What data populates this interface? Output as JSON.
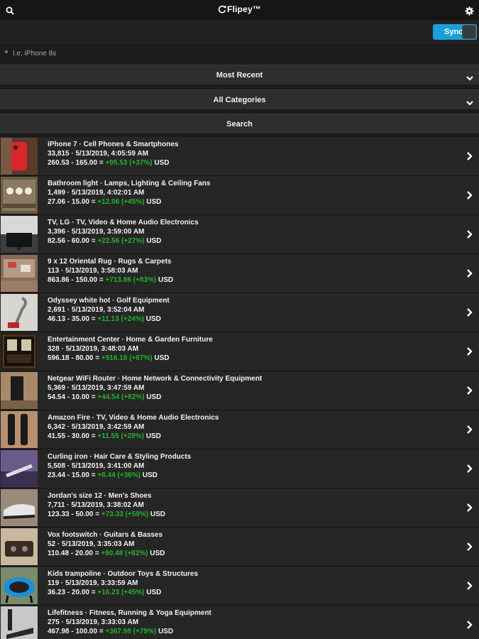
{
  "header": {
    "app_name": "Flipey™",
    "search_icon": "search-icon",
    "settings_icon": "gear-icon"
  },
  "sync": {
    "label": "Sync",
    "enabled": true,
    "color": "#1a9fd9"
  },
  "search": {
    "placeholder": "I.e. iPhone 8s",
    "value": ""
  },
  "sort": {
    "selected": "Most Recent"
  },
  "category": {
    "selected": "All Categories"
  },
  "search_button": "Search",
  "colors": {
    "gain": "#25b22c",
    "accent": "#1a9fd9"
  },
  "items": [
    {
      "title": "iPhone 7 · Cell Phones & Smartphones",
      "meta": "33,815 · 5/13/2019, 4:05:59 AM",
      "price_calc": "260.53 - 165.00 = ",
      "gain": "+95.53 (+37%)",
      "currency": " USD"
    },
    {
      "title": "Bathroom light · Lamps, Lighting & Ceiling Fans",
      "meta": "1,499 · 5/13/2019, 4:02:01 AM",
      "price_calc": "27.06 - 15.00 = ",
      "gain": "+12.06 (+45%)",
      "currency": " USD"
    },
    {
      "title": "TV, LG · TV, Video & Home Audio Electronics",
      "meta": "3,396 · 5/13/2019, 3:59:00 AM",
      "price_calc": "82.56 - 60.00 = ",
      "gain": "+22.56 (+27%)",
      "currency": " USD"
    },
    {
      "title": "9 x 12 Oriental Rug · Rugs & Carpets",
      "meta": "113 · 5/13/2019, 3:58:03 AM",
      "price_calc": "863.86 - 150.00 = ",
      "gain": "+713.86 (+83%)",
      "currency": " USD"
    },
    {
      "title": "Odyssey white hot · Golf Equipment",
      "meta": "2,691 · 5/13/2019, 3:52:04 AM",
      "price_calc": "46.13 - 35.00 = ",
      "gain": "+11.13 (+24%)",
      "currency": " USD"
    },
    {
      "title": "Entertainment Center · Home & Garden Furniture",
      "meta": "328 · 5/13/2019, 3:48:03 AM",
      "price_calc": "596.18 - 80.00 = ",
      "gain": "+516.18 (+87%)",
      "currency": " USD"
    },
    {
      "title": "Netgear WiFi Router · Home Network & Connectivity Equipment",
      "meta": "5,369 · 5/13/2019, 3:47:59 AM",
      "price_calc": "54.54 - 10.00 = ",
      "gain": "+44.54 (+82%)",
      "currency": " USD"
    },
    {
      "title": "Amazon Fire · TV, Video & Home Audio Electronics",
      "meta": "6,342 · 5/13/2019, 3:42:59 AM",
      "price_calc": "41.55 - 30.00 = ",
      "gain": "+11.55 (+28%)",
      "currency": " USD"
    },
    {
      "title": "Curling iron · Hair Care & Styling Products",
      "meta": "5,508 · 5/13/2019, 3:41:00 AM",
      "price_calc": "23.44 - 15.00 = ",
      "gain": "+8.44 (+36%)",
      "currency": " USD"
    },
    {
      "title": "Jordan's size 12 · Men's Shoes",
      "meta": "7,711 · 5/13/2019, 3:38:02 AM",
      "price_calc": "123.33 - 50.00 = ",
      "gain": "+73.33 (+59%)",
      "currency": " USD"
    },
    {
      "title": "Vox footswitch · Guitars & Basses",
      "meta": "52 · 5/13/2019, 3:35:03 AM",
      "price_calc": "110.48 - 20.00 = ",
      "gain": "+90.48 (+82%)",
      "currency": " USD"
    },
    {
      "title": "Kids trampoline · Outdoor Toys & Structures",
      "meta": "119 · 5/13/2019, 3:33:59 AM",
      "price_calc": "36.23 - 20.00 = ",
      "gain": "+16.23 (+45%)",
      "currency": " USD"
    },
    {
      "title": "Lifefitness · Fitness, Running & Yoga Equipment",
      "meta": "275 · 5/13/2019, 3:33:03 AM",
      "price_calc": "467.98 - 100.00 = ",
      "gain": "+367.98 (+79%)",
      "currency": " USD"
    }
  ]
}
